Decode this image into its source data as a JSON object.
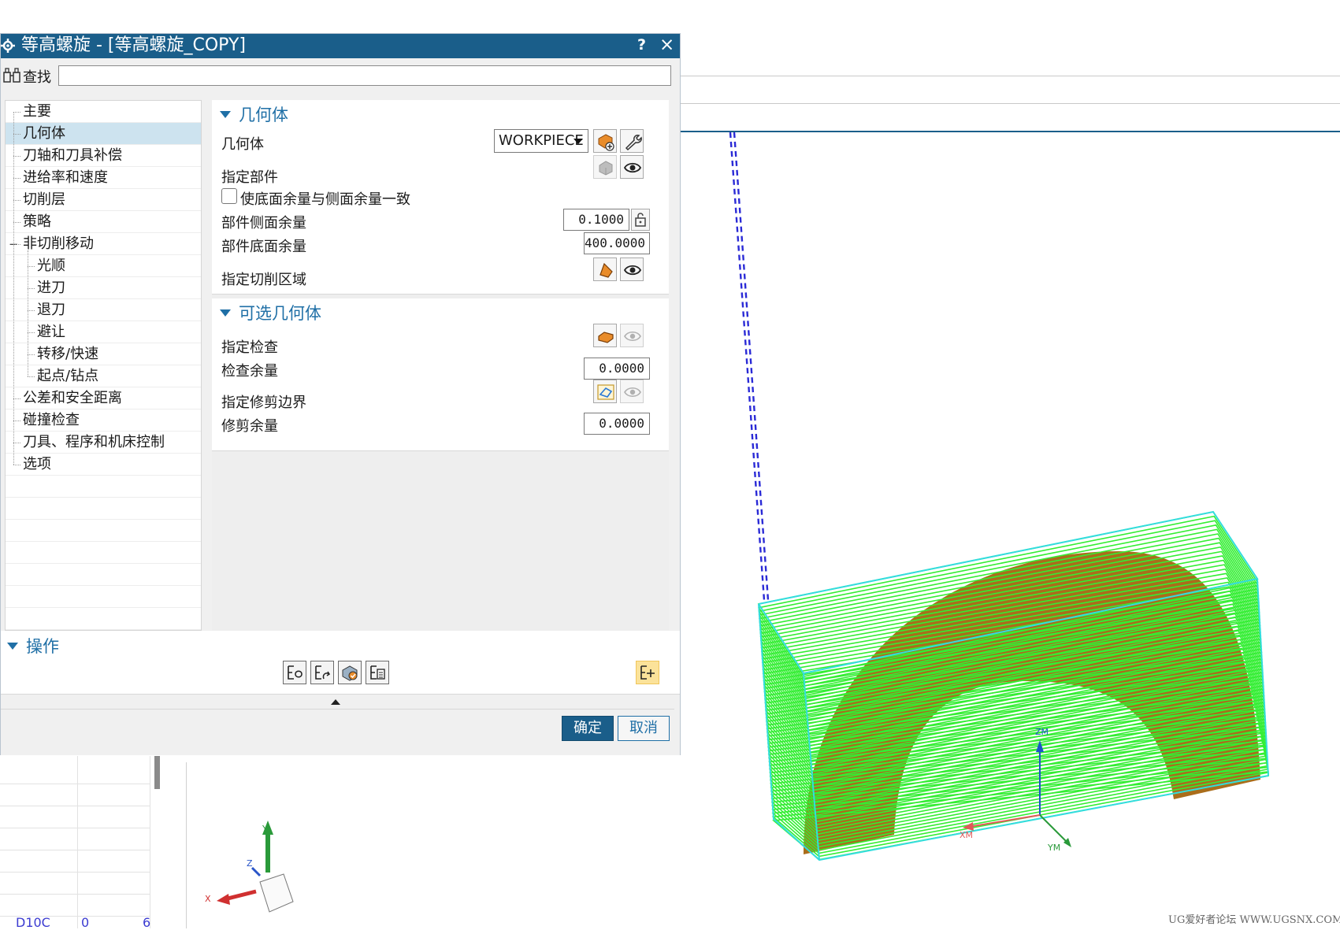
{
  "dialog": {
    "title": "等高螺旋 - [等高螺旋_COPY]",
    "help": "?",
    "close": "×",
    "find_label": "查找",
    "find_value": ""
  },
  "tree": {
    "items": [
      {
        "label": "主要",
        "level": 0,
        "selected": false
      },
      {
        "label": "几何体",
        "level": 0,
        "selected": true
      },
      {
        "label": "刀轴和刀具补偿",
        "level": 0,
        "selected": false
      },
      {
        "label": "进给率和速度",
        "level": 0,
        "selected": false
      },
      {
        "label": "切削层",
        "level": 0,
        "selected": false
      },
      {
        "label": "策略",
        "level": 0,
        "selected": false
      },
      {
        "label": "非切削移动",
        "level": 0,
        "selected": false,
        "expanded": true
      },
      {
        "label": "光顺",
        "level": 1,
        "selected": false
      },
      {
        "label": "进刀",
        "level": 1,
        "selected": false
      },
      {
        "label": "退刀",
        "level": 1,
        "selected": false
      },
      {
        "label": "避让",
        "level": 1,
        "selected": false
      },
      {
        "label": "转移/快速",
        "level": 1,
        "selected": false
      },
      {
        "label": "起点/钻点",
        "level": 1,
        "selected": false
      },
      {
        "label": "公差和安全距离",
        "level": 0,
        "selected": false
      },
      {
        "label": "碰撞检查",
        "level": 0,
        "selected": false
      },
      {
        "label": "刀具、程序和机床控制",
        "level": 0,
        "selected": false
      },
      {
        "label": "选项",
        "level": 0,
        "selected": false
      }
    ],
    "expander": "−"
  },
  "geometry_group": {
    "header": "几何体",
    "geometry_label": "几何体",
    "geometry_value": "WORKPIECE",
    "specify_part_label": "指定部件",
    "uniform_stock_label": "使底面余量与侧面余量一致",
    "uniform_stock_checked": false,
    "side_stock_label": "部件侧面余量",
    "side_stock_value": "0.1000",
    "floor_stock_label": "部件底面余量",
    "floor_stock_value": "400.0000",
    "cut_area_label": "指定切削区域"
  },
  "optional_group": {
    "header": "可选几何体",
    "check_label": "指定检查",
    "check_stock_label": "检查余量",
    "check_stock_value": "0.0000",
    "trim_label": "指定修剪边界",
    "trim_stock_label": "修剪余量",
    "trim_stock_value": "0.0000"
  },
  "operations": {
    "header": "操作"
  },
  "footer": {
    "ok": "确定",
    "cancel": "取消"
  },
  "viewport": {
    "axis_labels": {
      "zm": "ZM",
      "xm": "XM",
      "ym": "YM",
      "x": "X",
      "y": "Y",
      "z": "Z"
    },
    "watermark": "UG爱好者论坛 WWW.UGSNX.COM"
  },
  "table_fragment": {
    "cells": [
      "D10C",
      "0",
      "6"
    ]
  },
  "colors": {
    "title_bar": "#1a5e8a",
    "accent": "#1f6fa6",
    "selection": "#cde3ef",
    "toolpath": "#33ee33",
    "part": "#a5650f",
    "blank_outline": "#33dddd",
    "rapid": "#2a2ad6"
  },
  "icons": [
    "settings-icon",
    "binoculars-icon",
    "new-geometry-icon",
    "edit-wrench-icon",
    "select-part-icon",
    "show-eye-icon",
    "lock-icon",
    "select-cut-area-icon",
    "select-check-icon",
    "select-trim-icon",
    "generate-icon",
    "replay-icon",
    "verify-icon",
    "list-icon",
    "customize-icon"
  ]
}
